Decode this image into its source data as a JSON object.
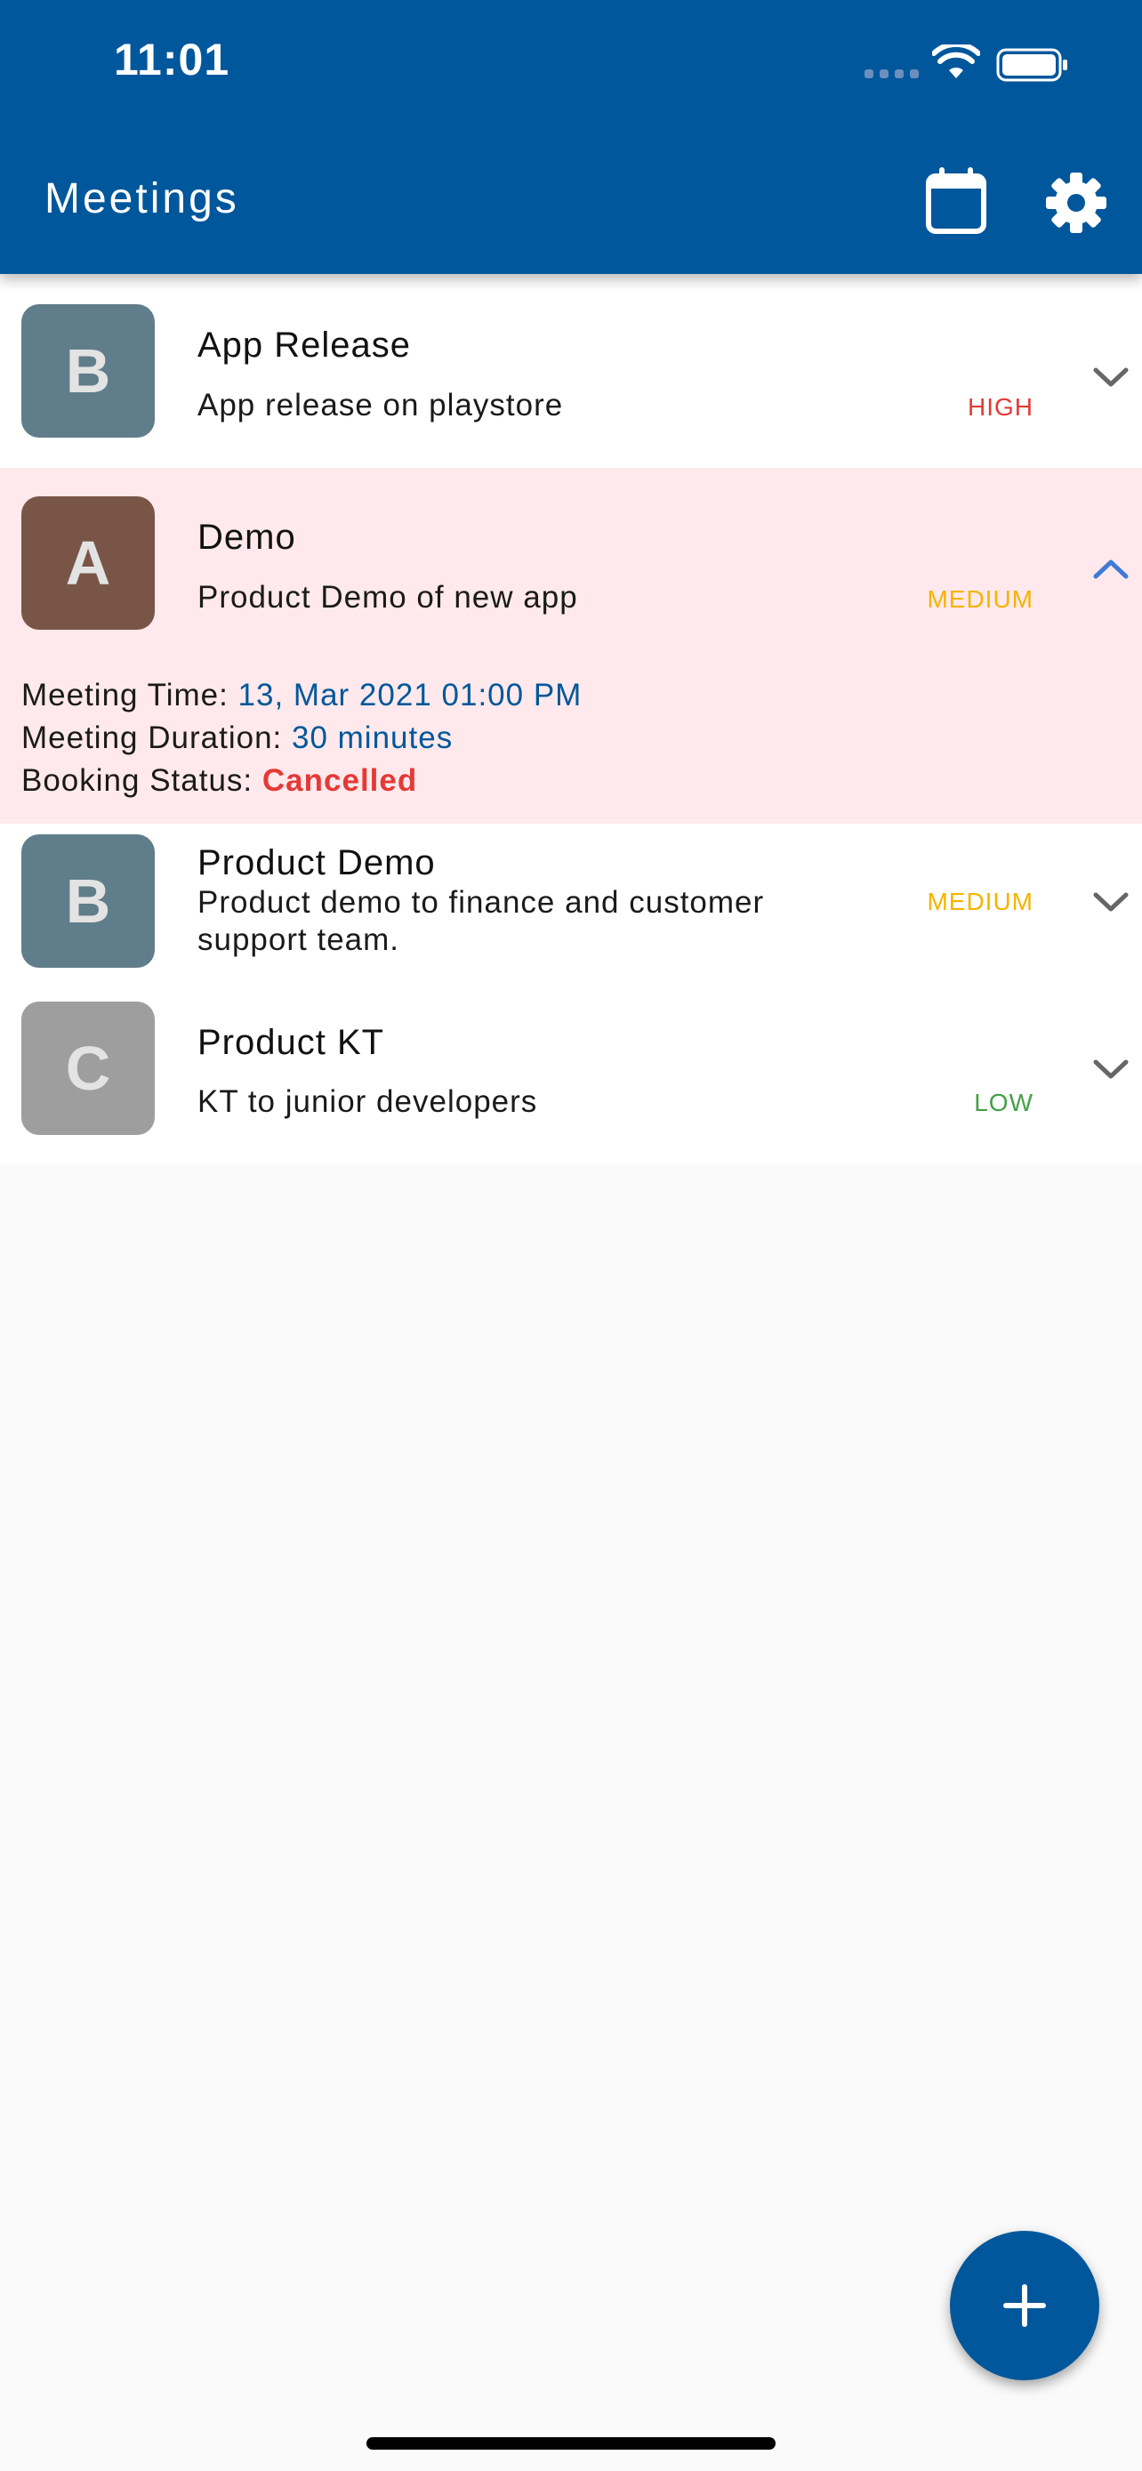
{
  "status_bar": {
    "time": "11:01"
  },
  "app_bar": {
    "title": "Meetings",
    "actions": [
      {
        "name": "calendar",
        "icon": "calendar-icon"
      },
      {
        "name": "settings",
        "icon": "gear-icon"
      }
    ]
  },
  "colors": {
    "primary": "#01579b",
    "expanded_row_bg": "#ffe9ec",
    "link_blue": "#01579b",
    "cancelled_red": "#e53935",
    "high": "#e53935",
    "medium": "#f4b400",
    "low": "#43a047"
  },
  "meetings": [
    {
      "avatar": "B",
      "title": "App Release",
      "description": "App release on playstore",
      "priority": "HIGH",
      "expanded": false
    },
    {
      "avatar": "A",
      "title": "Demo",
      "description": "Product Demo of new app",
      "priority": "MEDIUM",
      "expanded": true,
      "details": {
        "time_label": "Meeting Time:",
        "time_value": "13, Mar 2021 01:00 PM",
        "duration_label": "Meeting Duration:",
        "duration_value": "30 minutes",
        "status_label": "Booking Status:",
        "status_value": "Cancelled"
      }
    },
    {
      "avatar": "B",
      "title": "Product Demo",
      "description": "Product demo to finance and customer support team.",
      "priority": "MEDIUM",
      "expanded": false
    },
    {
      "avatar": "C",
      "title": "Product KT",
      "description": "KT to junior developers",
      "priority": "LOW",
      "expanded": false
    }
  ],
  "fab": {
    "icon": "plus-icon"
  }
}
